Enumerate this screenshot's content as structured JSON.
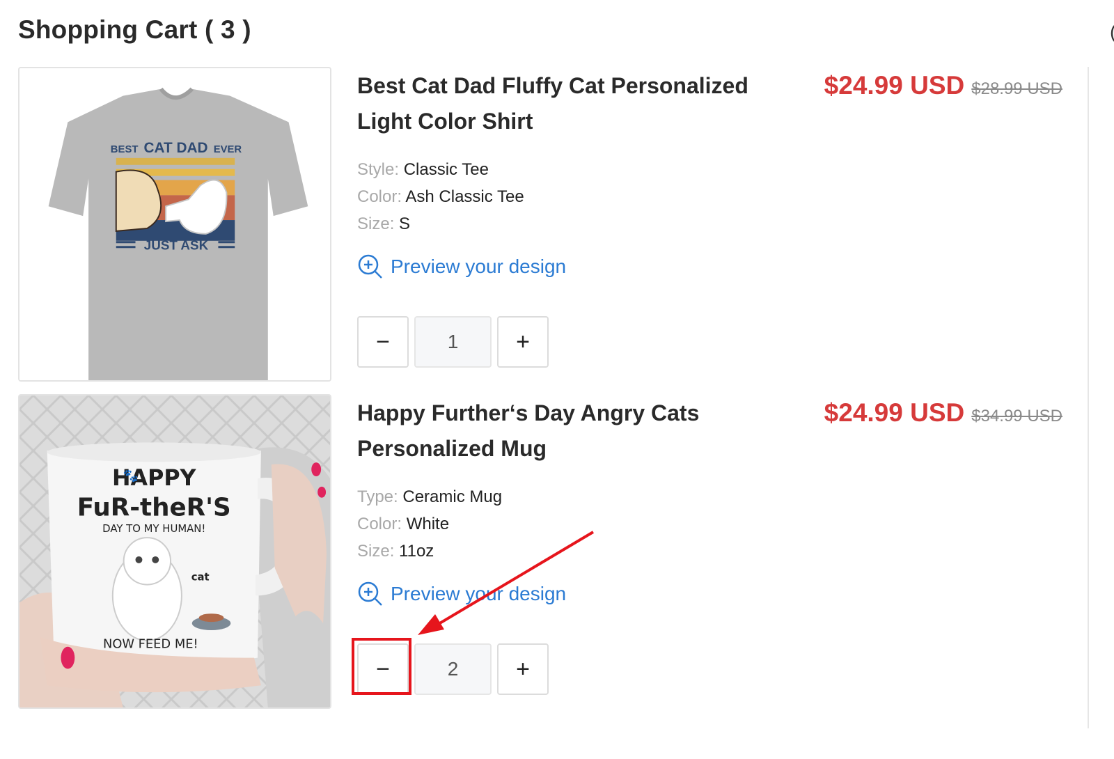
{
  "header": {
    "title": "Shopping Cart ( 3 )"
  },
  "items": [
    {
      "name": "Best Cat Dad Fluffy Cat Personalized Light Color Shirt",
      "price": "$24.99 USD",
      "old_price": "$28.99 USD",
      "attributes": [
        {
          "key": "Style:",
          "value": "Classic Tee"
        },
        {
          "key": "Color:",
          "value": "Ash Classic Tee"
        },
        {
          "key": "Size:",
          "value": "S"
        }
      ],
      "preview_label": "Preview your design",
      "quantity": "1",
      "image": {
        "line1_a": "BEST",
        "line1_b": "CAT DAD",
        "line1_c": "EVER",
        "line2": "JUST ASK"
      }
    },
    {
      "name": "Happy Further‘s Day Angry Cats Personalized Mug",
      "price": "$24.99 USD",
      "old_price": "$34.99 USD",
      "attributes": [
        {
          "key": "Type:",
          "value": "Ceramic Mug"
        },
        {
          "key": "Color:",
          "value": "White"
        },
        {
          "key": "Size:",
          "value": "11oz"
        }
      ],
      "preview_label": "Preview your design",
      "quantity": "2",
      "image": {
        "line1": "HAPPY",
        "line2": "FuR-theR'S",
        "line3": "DAY TO MY HUMAN!",
        "label": "cat",
        "line4": "NOW FEED ME!"
      }
    }
  ],
  "qty_controls": {
    "minus": "−",
    "plus": "+"
  },
  "annotation": {
    "color": "#e6151c"
  },
  "colors": {
    "price": "#d63a3a",
    "link": "#2b7bd3",
    "muted": "#a8a8a8"
  }
}
